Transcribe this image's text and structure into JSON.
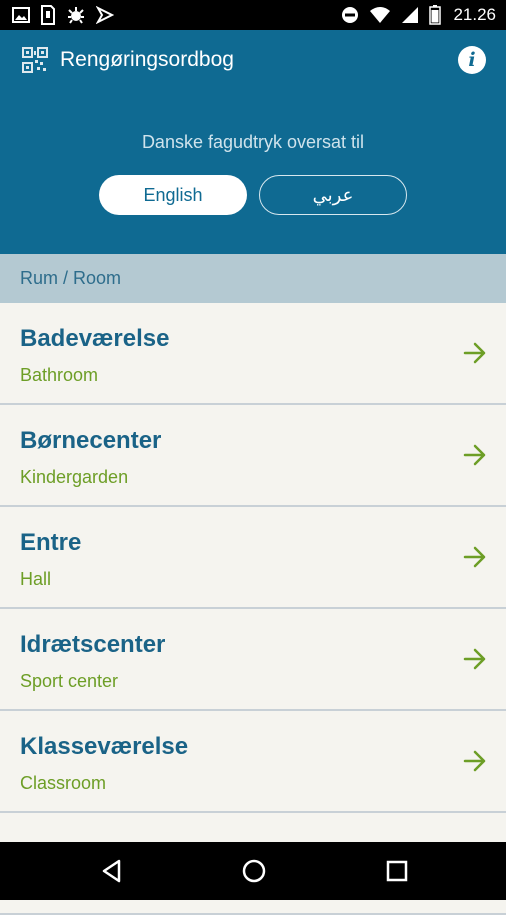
{
  "status_bar": {
    "time": "21.26",
    "left_icons": [
      "gallery-icon",
      "sim-card-icon",
      "usb-debug-icon",
      "notification-icon"
    ],
    "right_icons": [
      "do-not-disturb-icon",
      "wifi-icon",
      "signal-icon",
      "battery-icon"
    ]
  },
  "app_bar": {
    "title": "Rengøringsordbog",
    "logo_icon": "qr-code-logo-icon",
    "info_icon": "info-icon"
  },
  "language": {
    "prompt": "Danske fagudtryk oversat til",
    "options": [
      {
        "label": "English",
        "selected": true
      },
      {
        "label": "عربي",
        "selected": false
      }
    ]
  },
  "section": {
    "header": "Rum / Room"
  },
  "rooms": [
    {
      "danish": "Badeværelse",
      "english": "Bathroom"
    },
    {
      "danish": "Børnecenter",
      "english": "Kindergarden"
    },
    {
      "danish": "Entre",
      "english": "Hall"
    },
    {
      "danish": "Idrætscenter",
      "english": "Sport center"
    },
    {
      "danish": "Klasseværelse",
      "english": "Classroom"
    }
  ],
  "colors": {
    "primary": "#0f6a92",
    "section_header_bg": "#b4c9d2",
    "title_text": "#1a6387",
    "subtitle_text": "#6d9e26",
    "list_bg": "#f5f4ef"
  },
  "nav_bar": {
    "icons": [
      "back-icon",
      "home-icon",
      "recents-icon"
    ]
  }
}
